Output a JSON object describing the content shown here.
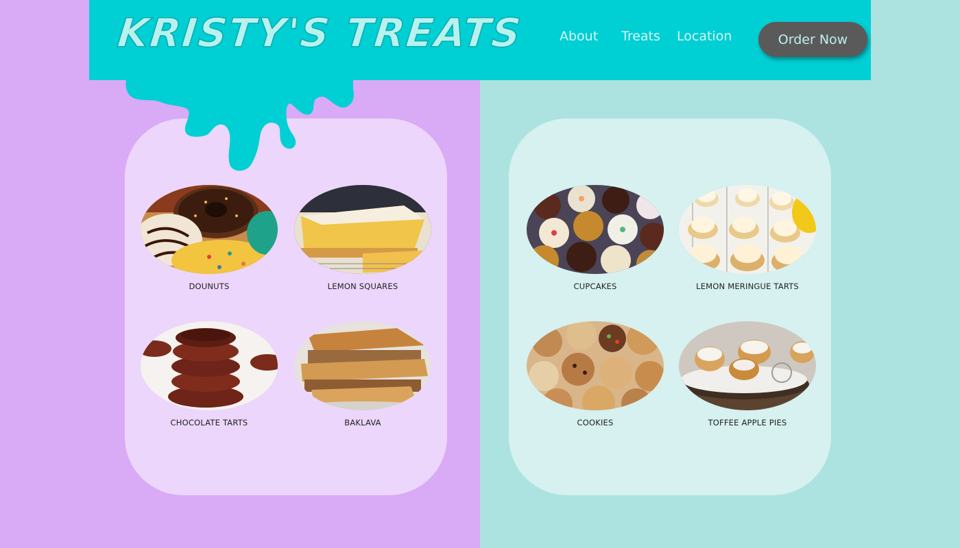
{
  "header": {
    "logo": "KRISTY'S TREATS",
    "nav": {
      "about": "About",
      "treats": "Treats",
      "location": "Location"
    },
    "order_button": "Order Now"
  },
  "left_panel": {
    "items": [
      {
        "label": "DOUNUTS"
      },
      {
        "label": "LEMON SQUARES"
      },
      {
        "label": "CHOCOLATE TARTS"
      },
      {
        "label": "BAKLAVA"
      }
    ]
  },
  "right_panel": {
    "items": [
      {
        "label": "CUPCAKES"
      },
      {
        "label": "LEMON MERINGUE TARTS"
      },
      {
        "label": "COOKIES"
      },
      {
        "label": "TOFFEE APPLE PIES"
      }
    ]
  },
  "colors": {
    "left_bg": "#d9aaf5",
    "right_bg": "#ace3e1",
    "header": "#00cfd4",
    "button": "#5a5a5a"
  }
}
